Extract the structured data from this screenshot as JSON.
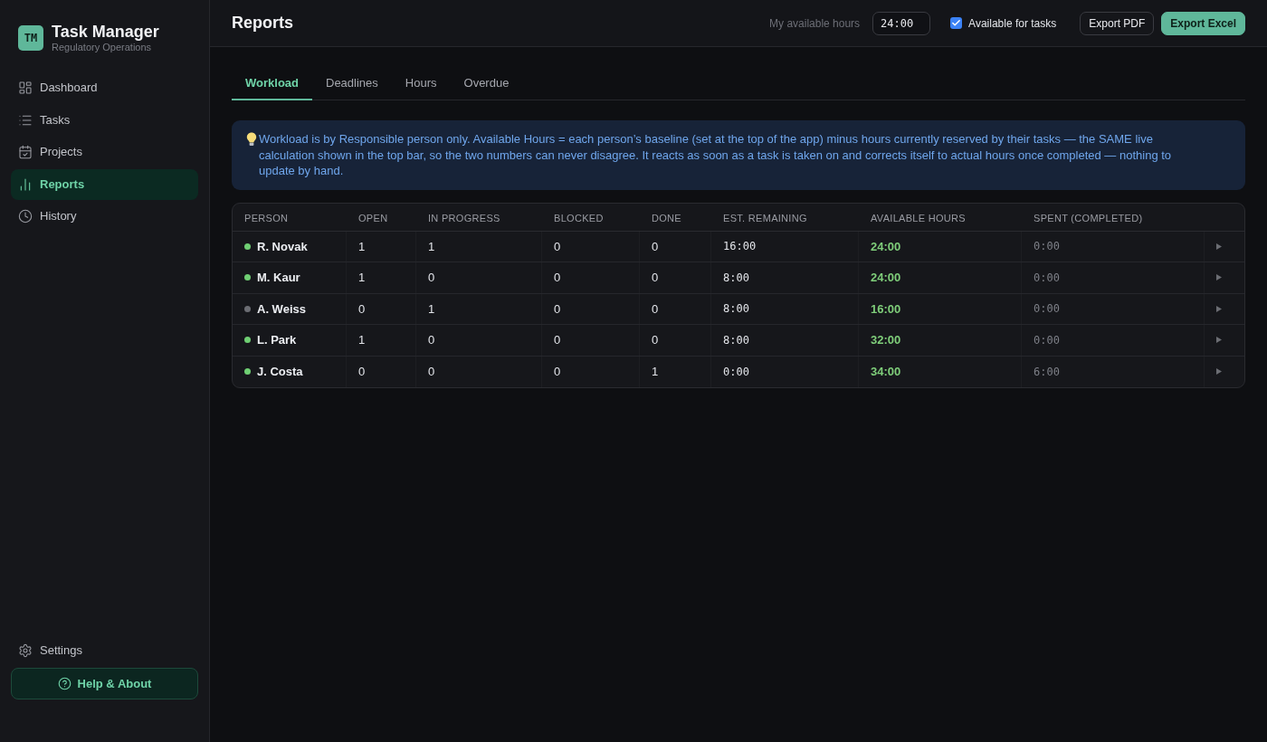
{
  "sidebar": {
    "logo": "TM",
    "title": "Task Manager",
    "subtitle": "Regulatory Operations",
    "nav": [
      {
        "label": "Dashboard",
        "selected": false
      },
      {
        "label": "Tasks",
        "selected": false
      },
      {
        "label": "Projects",
        "selected": false
      },
      {
        "label": "Reports",
        "selected": true
      },
      {
        "label": "History",
        "selected": false
      }
    ],
    "settings": "Settings",
    "help_button": "Help & About"
  },
  "topbar": {
    "title": "Reports",
    "hours_label": "My available hours",
    "hours_value": "24:00",
    "available": {
      "label": "Available for tasks",
      "checked": true
    },
    "buttons": [
      {
        "label": "Export PDF",
        "kind": "outline"
      },
      {
        "label": "Export Excel",
        "kind": "primary"
      }
    ]
  },
  "tabs": [
    {
      "label": "Workload",
      "selected": true
    },
    {
      "label": "Deadlines",
      "selected": false
    },
    {
      "label": "Hours",
      "selected": false
    },
    {
      "label": "Overdue",
      "selected": false
    }
  ],
  "notice": "Workload is by Responsible person only. Available Hours = each person’s baseline (set at the top of the app) minus hours currently reserved by their tasks — the SAME live calculation shown in the top bar, so the two numbers can never disagree. It reacts as soon as a task is taken on and corrects itself to actual hours once completed — nothing to update by hand.",
  "table": {
    "columns": [
      {
        "label": "PERSON",
        "kind": "person"
      },
      {
        "label": "OPEN",
        "kind": "count"
      },
      {
        "label": "IN PROGRESS",
        "kind": "count"
      },
      {
        "label": "BLOCKED",
        "kind": "count"
      },
      {
        "label": "DONE",
        "kind": "count"
      },
      {
        "label": "EST. REMAINING",
        "kind": "time"
      },
      {
        "label": "AVAILABLE HOURS",
        "kind": "available"
      },
      {
        "label": "SPENT (COMPLETED)",
        "kind": "spent"
      }
    ],
    "rows": [
      {
        "color": "#6fcf73",
        "cells": [
          "R. Novak",
          "1",
          "1",
          "0",
          "0",
          "16:00",
          "24:00",
          "0:00"
        ]
      },
      {
        "color": "#6fcf73",
        "cells": [
          "M. Kaur",
          "1",
          "0",
          "0",
          "0",
          "8:00",
          "24:00",
          "0:00"
        ]
      },
      {
        "color": "#6b6d73",
        "cells": [
          "A. Weiss",
          "0",
          "1",
          "0",
          "0",
          "8:00",
          "16:00",
          "0:00"
        ]
      },
      {
        "color": "#6fcf73",
        "cells": [
          "L. Park",
          "1",
          "0",
          "0",
          "0",
          "8:00",
          "32:00",
          "0:00"
        ]
      },
      {
        "color": "#6fcf73",
        "cells": [
          "J. Costa",
          "0",
          "0",
          "0",
          "1",
          "0:00",
          "34:00",
          "6:00"
        ]
      }
    ]
  }
}
